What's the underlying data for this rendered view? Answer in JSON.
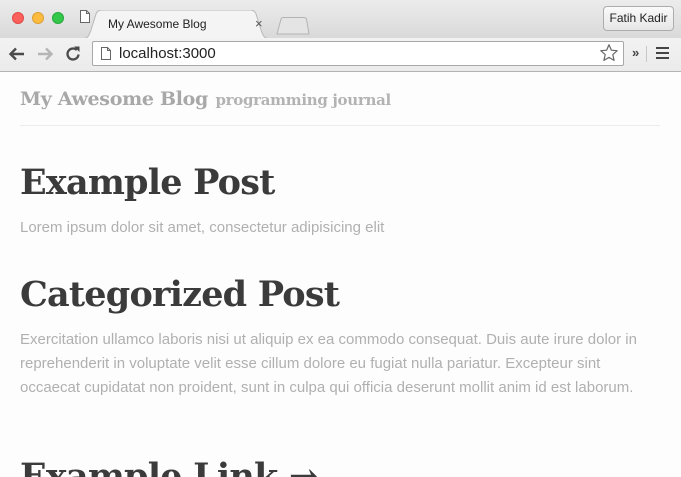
{
  "browser": {
    "tab_title": "My Awesome Blog",
    "tab_close": "×",
    "profile_name": "Fatih Kadir",
    "url": "localhost:3000",
    "extensions_chevron": "»"
  },
  "site": {
    "title": "My Awesome Blog",
    "tagline": "programming journal"
  },
  "posts": [
    {
      "title": "Example Post",
      "excerpt": "Lorem ipsum dolor sit amet, consectetur adipisicing elit"
    },
    {
      "title": "Categorized Post",
      "excerpt": "Exercitation ullamco laboris nisi ut aliquip ex ea commodo consequat. Duis aute irure dolor in reprehenderit in voluptate velit esse cillum dolore eu fugiat nulla pariatur. Excepteur sint occaecat cupidatat non proident, sunt in culpa qui officia deserunt mollit anim id est laborum."
    },
    {
      "title": "Example Link →",
      "excerpt": ""
    }
  ],
  "colors": {
    "close": "#fc605c",
    "minimize": "#fdbc40",
    "maximize": "#34c84a",
    "heading": "#3b3b3b",
    "muted": "#b0b0b0"
  }
}
